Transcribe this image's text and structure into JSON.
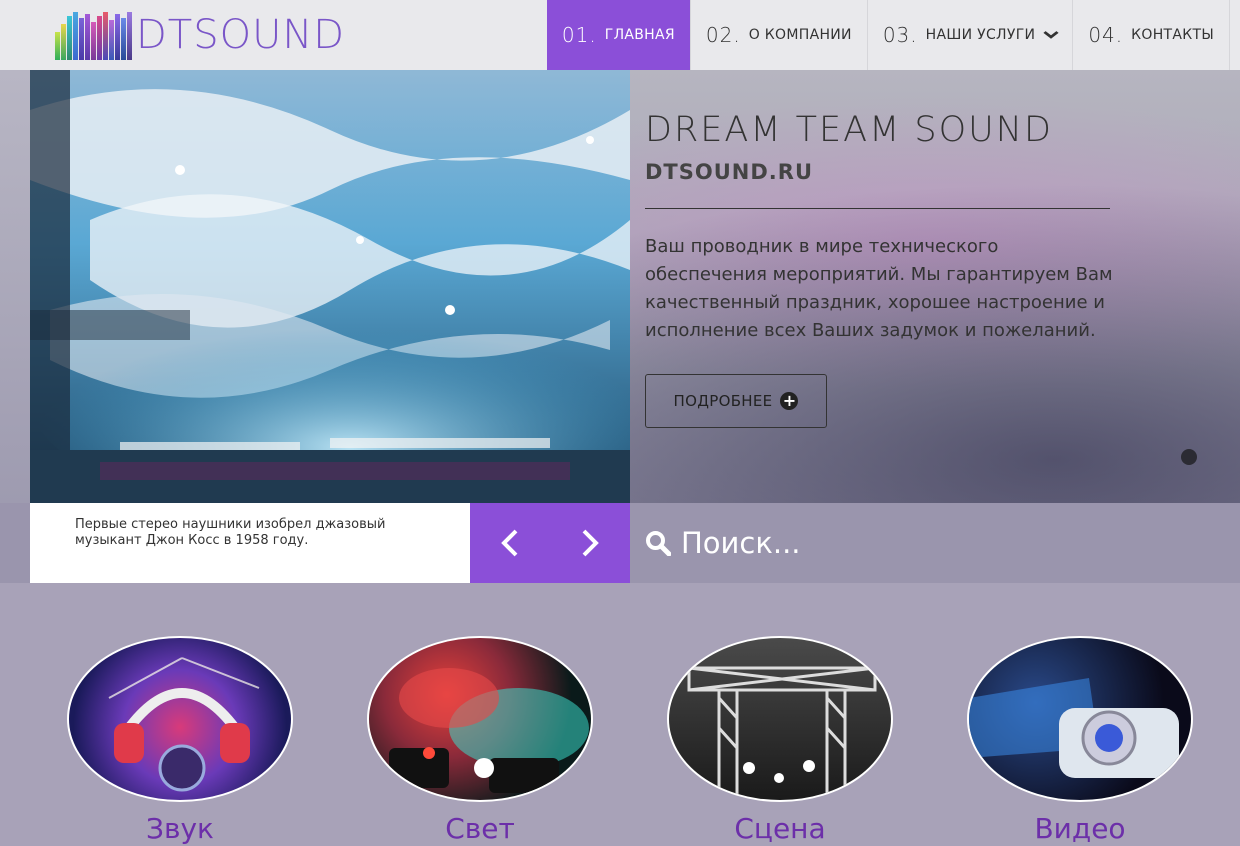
{
  "header": {
    "logo_text": "DTSOUND",
    "nav": [
      {
        "num": "01.",
        "label": "главная"
      },
      {
        "num": "02.",
        "label": "о компании"
      },
      {
        "num": "03.",
        "label": "наши услуги"
      },
      {
        "num": "04.",
        "label": "контакты"
      }
    ]
  },
  "hero": {
    "title": "DREAM TEAM SOUND",
    "subtitle": "DTSOUND.RU",
    "description": "Ваш проводник в мире технического обеспечения мероприятий. Мы гарантируем Вам качественный праздник, хорошее настроение и исполнение всех Ваших задумок и пожеланий.",
    "button_label": "Подробнее"
  },
  "fact": {
    "text": "Первые стерео наушники изобрел джазовый музыкант Джон Косс в 1958 году."
  },
  "search": {
    "placeholder": "Поиск..."
  },
  "services": [
    {
      "label": "Звук"
    },
    {
      "label": "Свет"
    },
    {
      "label": "Сцена"
    },
    {
      "label": "Видео"
    }
  ],
  "colors": {
    "accent": "#8b4fd8",
    "service_label": "#6c2fa9",
    "logo_text": "#7a56c8"
  },
  "icons": {
    "hero_button": "plus-circle-icon",
    "search": "search-icon",
    "prev": "chevron-left-icon",
    "next": "chevron-right-icon",
    "dropdown": "chevron-down-icon"
  }
}
